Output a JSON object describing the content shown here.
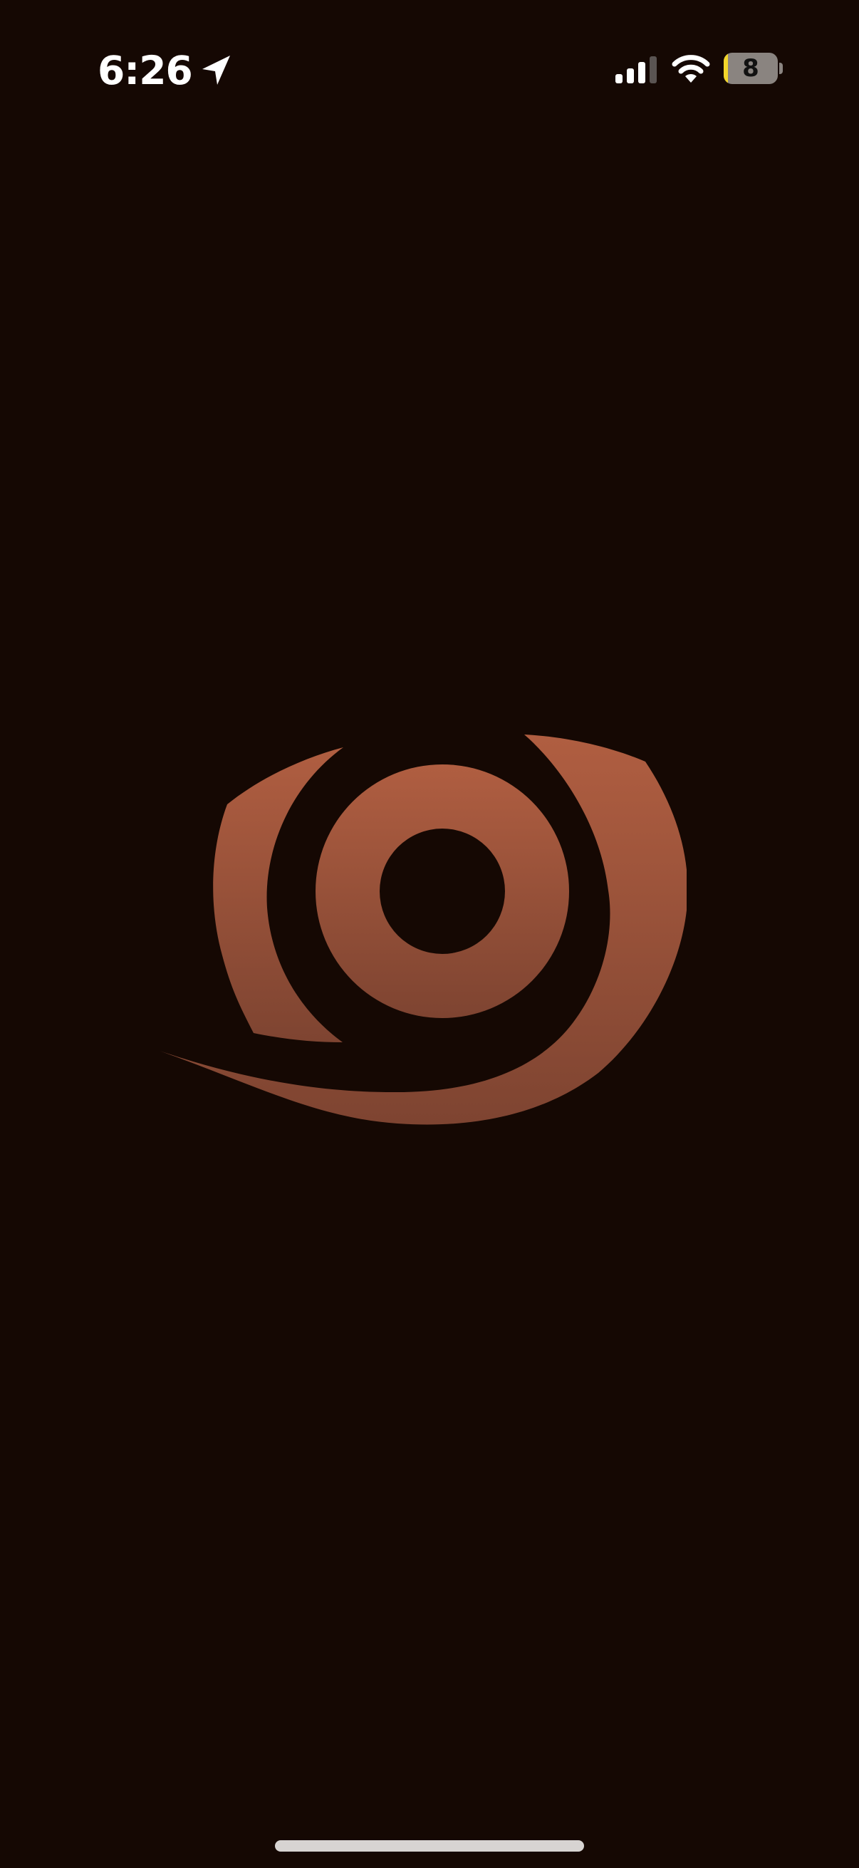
{
  "status_bar": {
    "time": "6:26",
    "location_icon": "location-arrow-icon",
    "signal_icon": "cellular-signal-icon",
    "signal_bars_active": 3,
    "signal_bars_total": 4,
    "wifi_icon": "wifi-icon",
    "battery": {
      "level": "8",
      "fill_fraction": 0.08,
      "fill_color": "#f2d62b"
    }
  },
  "splash": {
    "logo_icon": "eye-swirl-logo-icon",
    "background_color": "#150803",
    "logo_color_top": "#b05e41",
    "logo_color_bottom": "#7e4431"
  }
}
